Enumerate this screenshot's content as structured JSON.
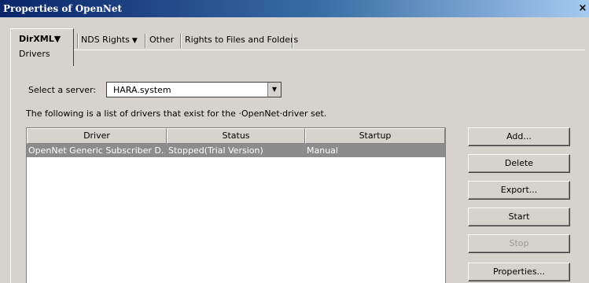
{
  "window": {
    "title": "Properties of OpenNet",
    "close_glyph": "×"
  },
  "tabs": {
    "active": {
      "label": "DirXML",
      "sub_label": "Drivers"
    },
    "items": [
      {
        "label": "NDS Rights",
        "has_dropdown": true
      },
      {
        "label": "Other",
        "has_dropdown": false
      },
      {
        "label": "Rights to Files and Folders",
        "has_dropdown": false
      }
    ]
  },
  "server": {
    "label": "Select a server:",
    "value": "HARA.system"
  },
  "info_text": "The following is a list of drivers that exist for the ·OpenNet·driver set.",
  "table": {
    "columns": [
      "Driver",
      "Status",
      "Startup"
    ],
    "rows": [
      [
        "OpenNet Generic Subscriber D...",
        "Stopped(Trial Version)",
        "Manual"
      ]
    ]
  },
  "buttons": {
    "add": "Add...",
    "delete": "Delete",
    "export": "Export...",
    "start": "Start",
    "stop": "Stop",
    "properties": "Properties..."
  },
  "colors": {
    "selection": "#8c8c8c",
    "titlebar": "#0a246a"
  }
}
